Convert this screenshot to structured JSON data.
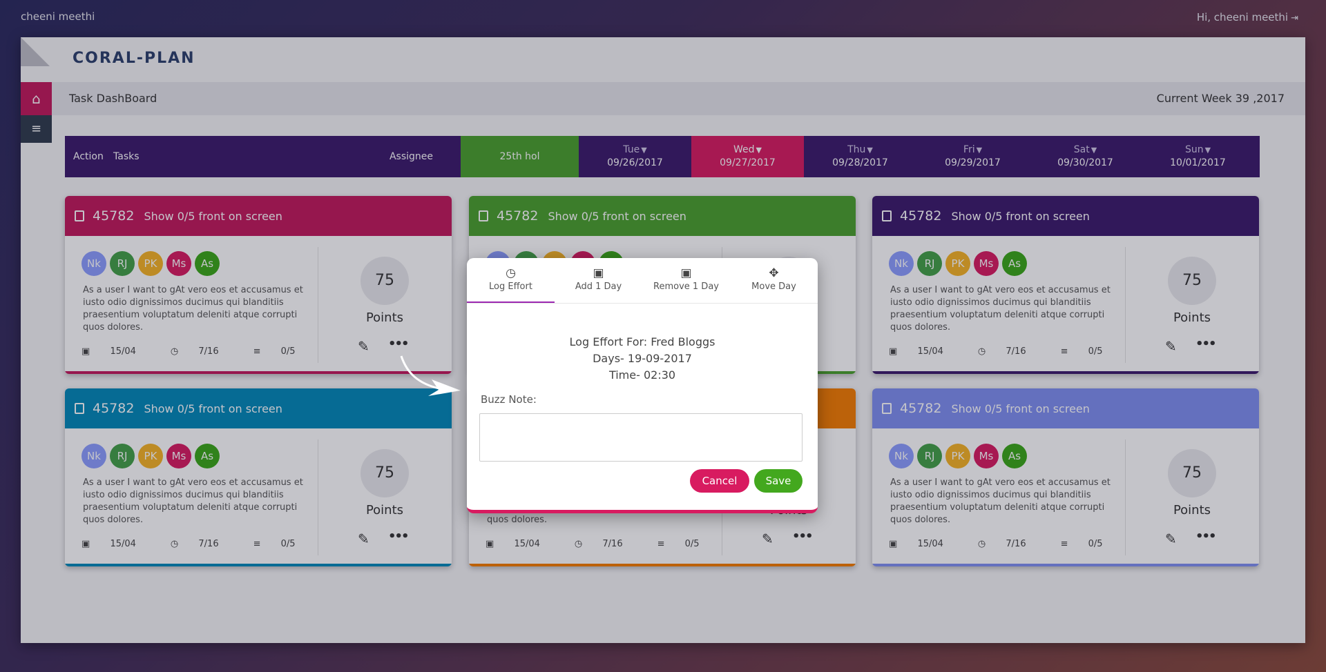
{
  "topbar": {
    "user": "cheeni meethi",
    "greeting": "Hi, cheeni meethi"
  },
  "app": {
    "brand": "CORAL-PLAN",
    "page_title": "Task DashBoard",
    "week": "Current Week 39 ,2017"
  },
  "header": {
    "action": "Action",
    "tasks": "Tasks",
    "assignee": "Assignee",
    "holiday": "25th hol",
    "days": [
      {
        "day": "Tue",
        "date": "09/26/2017"
      },
      {
        "day": "Wed",
        "date": "09/27/2017"
      },
      {
        "day": "Thu",
        "date": "09/28/2017"
      },
      {
        "day": "Fri",
        "date": "09/29/2017"
      },
      {
        "day": "Sat",
        "date": "09/30/2017"
      },
      {
        "day": "Sun",
        "date": "10/01/2017"
      }
    ]
  },
  "card": {
    "id": "45782",
    "title": "Show 0/5 front on screen",
    "avatars": [
      "Nk",
      "RJ",
      "PK",
      "Ms",
      "As"
    ],
    "description": "As a user I want to gAt vero eos et accusamus et iusto odio dignissimos ducimus qui blanditiis praesentium voluptatum deleniti atque corrupti quos dolores.",
    "date": "15/04",
    "time": "7/16",
    "progress": "0/5",
    "points": "75",
    "points_label": "Points"
  },
  "colors": {
    "card1": "#c2185b",
    "card2": "#4aa02c",
    "card3": "#3b1a6b",
    "card4": "#0288b8",
    "card5": "#f57c00",
    "card6": "#7f8ff0",
    "avatar_nk": "#8c9eff",
    "avatar_rj": "#43a047",
    "avatar_pk": "#f6b324",
    "avatar_ms": "#d81b60",
    "avatar_as": "#3aa717"
  },
  "modal": {
    "tabs": [
      "Log Effort",
      "Add 1 Day",
      "Remove 1 Day",
      "Move Day"
    ],
    "log_for": "Log Effort For: Fred Bloggs",
    "days": "Days- 19-09-2017",
    "time": "Time- 02:30",
    "buzz_label": "Buzz Note:",
    "cancel": "Cancel",
    "save": "Save"
  }
}
